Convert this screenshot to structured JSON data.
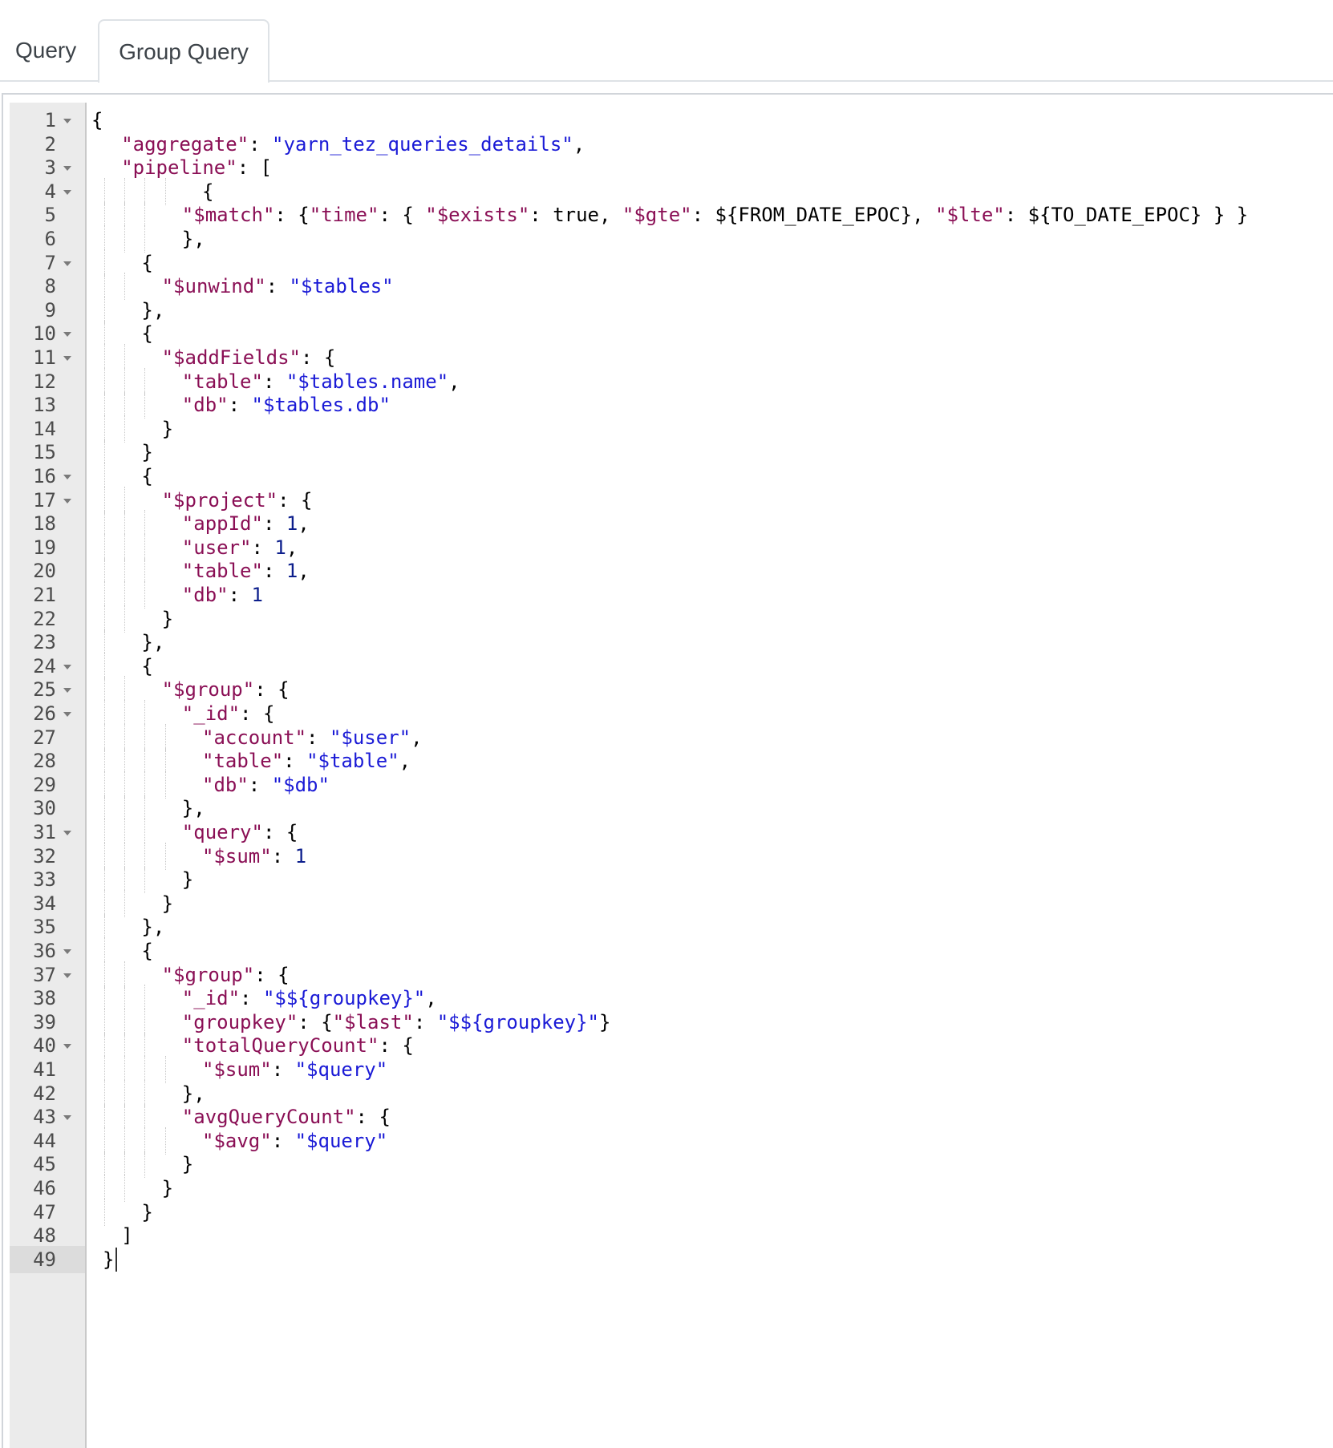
{
  "tabs": [
    {
      "label": "Query",
      "active": false
    },
    {
      "label": "Group Query",
      "active": true
    }
  ],
  "editor": {
    "active_line": 49,
    "fold_lines": [
      1,
      3,
      4,
      7,
      10,
      11,
      16,
      17,
      24,
      25,
      26,
      31,
      36,
      37,
      40,
      43
    ],
    "colors": {
      "key": "#8a0f55",
      "string": "#1a1ad6",
      "number": "#0c1e8c",
      "punct": "#000000"
    },
    "lines": [
      {
        "n": 1,
        "depth": 0,
        "code": "{"
      },
      {
        "n": 2,
        "depth": 1,
        "code": "\"aggregate\": \"yarn_tez_queries_details\","
      },
      {
        "n": 3,
        "depth": 1,
        "code": "\"pipeline\": ["
      },
      {
        "n": 4,
        "depth": 5,
        "code": "{"
      },
      {
        "n": 5,
        "depth": 4,
        "code": "\"$match\": {\"time\": { \"$exists\": true, \"$gte\": ${FROM_DATE_EPOC}, \"$lte\": ${TO_DATE_EPOC} } }"
      },
      {
        "n": 6,
        "depth": 4,
        "code": "},"
      },
      {
        "n": 7,
        "depth": 2,
        "code": "{"
      },
      {
        "n": 8,
        "depth": 3,
        "code": "\"$unwind\": \"$tables\""
      },
      {
        "n": 9,
        "depth": 2,
        "code": "},"
      },
      {
        "n": 10,
        "depth": 2,
        "code": "{"
      },
      {
        "n": 11,
        "depth": 3,
        "code": "\"$addFields\": {"
      },
      {
        "n": 12,
        "depth": 4,
        "code": "\"table\": \"$tables.name\","
      },
      {
        "n": 13,
        "depth": 4,
        "code": "\"db\": \"$tables.db\""
      },
      {
        "n": 14,
        "depth": 3,
        "code": "}"
      },
      {
        "n": 15,
        "depth": 2,
        "code": "}"
      },
      {
        "n": 16,
        "depth": 2,
        "code": "{"
      },
      {
        "n": 17,
        "depth": 3,
        "code": "\"$project\": {"
      },
      {
        "n": 18,
        "depth": 4,
        "code": "\"appId\": 1,"
      },
      {
        "n": 19,
        "depth": 4,
        "code": "\"user\": 1,"
      },
      {
        "n": 20,
        "depth": 4,
        "code": "\"table\": 1,"
      },
      {
        "n": 21,
        "depth": 4,
        "code": "\"db\": 1"
      },
      {
        "n": 22,
        "depth": 3,
        "code": "}"
      },
      {
        "n": 23,
        "depth": 2,
        "code": "},"
      },
      {
        "n": 24,
        "depth": 2,
        "code": "{"
      },
      {
        "n": 25,
        "depth": 3,
        "code": "\"$group\": {"
      },
      {
        "n": 26,
        "depth": 4,
        "code": "\"_id\": {"
      },
      {
        "n": 27,
        "depth": 5,
        "code": "\"account\": \"$user\","
      },
      {
        "n": 28,
        "depth": 5,
        "code": "\"table\": \"$table\","
      },
      {
        "n": 29,
        "depth": 5,
        "code": "\"db\": \"$db\""
      },
      {
        "n": 30,
        "depth": 4,
        "code": "},"
      },
      {
        "n": 31,
        "depth": 4,
        "code": "\"query\": {"
      },
      {
        "n": 32,
        "depth": 5,
        "code": "\"$sum\": 1"
      },
      {
        "n": 33,
        "depth": 4,
        "code": "}"
      },
      {
        "n": 34,
        "depth": 3,
        "code": "}"
      },
      {
        "n": 35,
        "depth": 2,
        "code": "},"
      },
      {
        "n": 36,
        "depth": 2,
        "code": "{"
      },
      {
        "n": 37,
        "depth": 3,
        "code": "\"$group\": {"
      },
      {
        "n": 38,
        "depth": 4,
        "code": "\"_id\": \"$${groupkey}\","
      },
      {
        "n": 39,
        "depth": 4,
        "code": "\"groupkey\": {\"$last\": \"$${groupkey}\"}"
      },
      {
        "n": 40,
        "depth": 4,
        "code": "\"totalQueryCount\": {"
      },
      {
        "n": 41,
        "depth": 5,
        "code": "\"$sum\": \"$query\""
      },
      {
        "n": 42,
        "depth": 4,
        "code": "},"
      },
      {
        "n": 43,
        "depth": 4,
        "code": "\"avgQueryCount\": {"
      },
      {
        "n": 44,
        "depth": 5,
        "code": "\"$avg\": \"$query\""
      },
      {
        "n": 45,
        "depth": 4,
        "code": "}"
      },
      {
        "n": 46,
        "depth": 3,
        "code": "}"
      },
      {
        "n": 47,
        "depth": 2,
        "code": "}"
      },
      {
        "n": 48,
        "depth": 1,
        "code": "]"
      },
      {
        "n": 49,
        "depth": 1,
        "code": "}"
      }
    ]
  }
}
